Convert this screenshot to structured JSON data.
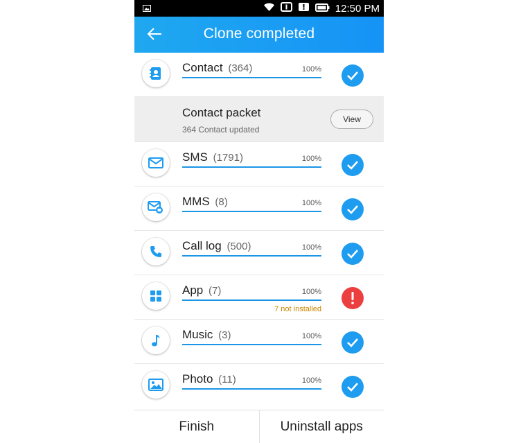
{
  "status_bar": {
    "time": "12:50 PM",
    "icons": [
      "image-icon",
      "wifi-icon",
      "notification-icon",
      "alert-icon",
      "battery-icon"
    ]
  },
  "header": {
    "title": "Clone completed",
    "back_icon": "back-arrow-icon"
  },
  "items": [
    {
      "name": "Contact",
      "count": "(364)",
      "percent": "100%",
      "progress": 1.0,
      "status": "ok",
      "icon": "contact-book-icon"
    },
    {
      "name": "SMS",
      "count": "(1791)",
      "percent": "100%",
      "progress": 1.0,
      "status": "ok",
      "icon": "envelope-icon"
    },
    {
      "name": "MMS",
      "count": "(8)",
      "percent": "100%",
      "progress": 1.0,
      "status": "ok",
      "icon": "mms-icon"
    },
    {
      "name": "Call log",
      "count": "(500)",
      "percent": "100%",
      "progress": 1.0,
      "status": "ok",
      "icon": "phone-icon"
    },
    {
      "name": "App",
      "count": "(7)",
      "percent": "100%",
      "progress": 1.0,
      "status": "error",
      "note": "7 not installed",
      "icon": "grid-apps-icon"
    },
    {
      "name": "Music",
      "count": "(3)",
      "percent": "100%",
      "progress": 1.0,
      "status": "ok",
      "icon": "music-note-icon"
    },
    {
      "name": "Photo",
      "count": "(11)",
      "percent": "100%",
      "progress": 1.0,
      "status": "ok",
      "icon": "picture-icon"
    }
  ],
  "contact_packet": {
    "title": "Contact packet",
    "subtitle": "364 Contact updated",
    "view_label": "View"
  },
  "footer": {
    "finish_label": "Finish",
    "uninstall_label": "Uninstall apps"
  },
  "colors": {
    "accent": "#1e9cf0",
    "header_start": "#1fa8f0",
    "header_end": "#1693f6",
    "error": "#ec4040",
    "warning_text": "#cc8500"
  }
}
